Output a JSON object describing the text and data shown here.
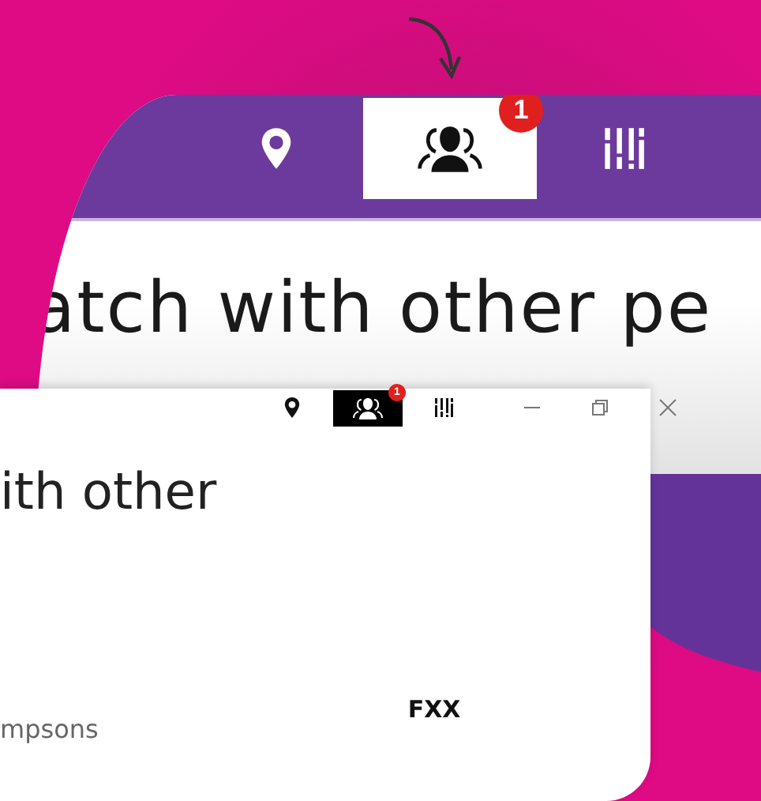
{
  "magnified_view": {
    "toolbar": [
      {
        "kind": "location",
        "selected": false
      },
      {
        "kind": "people",
        "selected": true,
        "badge": "1"
      },
      {
        "kind": "equalizer",
        "selected": false
      }
    ],
    "heading": "atch with other pe"
  },
  "window": {
    "toolbar": [
      {
        "kind": "location",
        "selected": false
      },
      {
        "kind": "people",
        "selected": true,
        "badge": "1"
      },
      {
        "kind": "equalizer",
        "selected": false
      }
    ],
    "window_controls": [
      {
        "kind": "minimize"
      },
      {
        "kind": "restore"
      },
      {
        "kind": "close"
      }
    ],
    "heading": "ith other",
    "show_title": "mpsons",
    "channel": "FXX"
  }
}
